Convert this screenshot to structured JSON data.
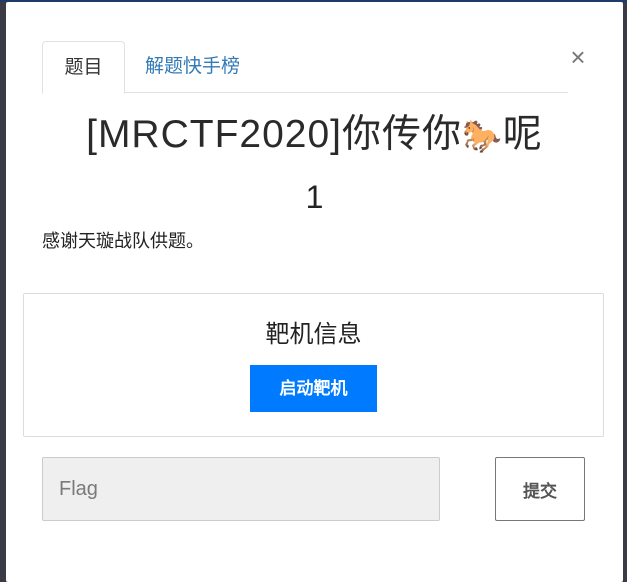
{
  "tabs": [
    {
      "label": "题目",
      "active": true
    },
    {
      "label": "解题快手榜",
      "active": false
    }
  ],
  "close_symbol": "×",
  "challenge": {
    "title_prefix": "[MRCTF2020]你传你",
    "title_emoji": "🐎",
    "title_suffix": "呢",
    "score": "1",
    "description": "感谢天璇战队供题。"
  },
  "target": {
    "heading": "靶机信息",
    "start_label": "启动靶机"
  },
  "flag": {
    "placeholder": "Flag",
    "value": "",
    "submit_label": "提交"
  },
  "colors": {
    "primary": "#007bff",
    "link": "#337ab7"
  }
}
